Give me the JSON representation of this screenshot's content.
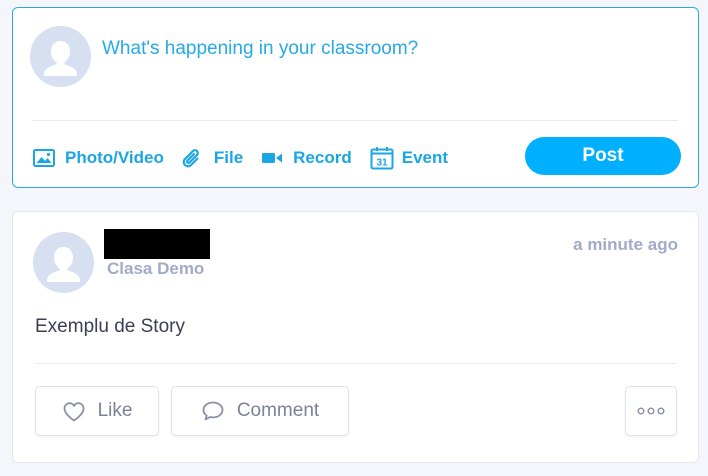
{
  "composer": {
    "placeholder": "What's happening in your classroom?",
    "actions": [
      {
        "label": "Photo/Video",
        "icon": "photo-icon"
      },
      {
        "label": "File",
        "icon": "paperclip-icon"
      },
      {
        "label": "Record",
        "icon": "video-camera-icon"
      },
      {
        "label": "Event",
        "icon": "calendar-icon"
      }
    ],
    "calendar_day": "31",
    "post_label": "Post"
  },
  "story": {
    "class_name": "Clasa Demo",
    "time": "a minute ago",
    "body": "Exemplu de Story",
    "like_label": "Like",
    "comment_label": "Comment",
    "more_icon": "ellipsis-icon"
  },
  "colors": {
    "accent": "#27a9e8",
    "post_button": "#00b0ff",
    "muted": "#a3aac9",
    "background": "#f5f6fb"
  }
}
